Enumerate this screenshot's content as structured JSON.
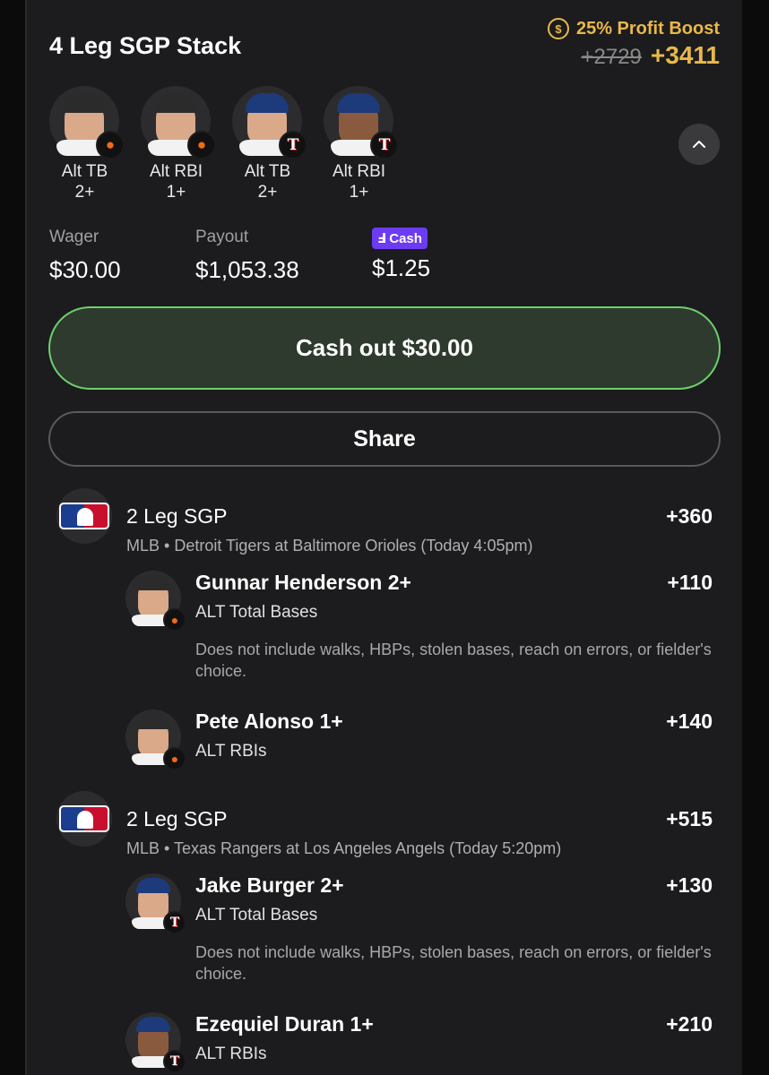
{
  "header": {
    "title": "4 Leg SGP Stack",
    "boost_label": "25% Profit Boost",
    "boost_icon": "dollar-coin-icon",
    "old_odds": "+2729",
    "new_odds": "+3411",
    "accent": "#e8b84a"
  },
  "legs": [
    {
      "label_line1": "Alt TB",
      "label_line2": "2+",
      "team": "BAL"
    },
    {
      "label_line1": "Alt RBI",
      "label_line2": "1+",
      "team": "BAL"
    },
    {
      "label_line1": "Alt TB",
      "label_line2": "2+",
      "team": "TEX"
    },
    {
      "label_line1": "Alt RBI",
      "label_line2": "1+",
      "team": "TEX"
    }
  ],
  "summary": {
    "wager_label": "Wager",
    "wager_value": "$30.00",
    "payout_label": "Payout",
    "payout_value": "$1,053.38",
    "fcash_label": "Cash",
    "fcash_value": "$1.25"
  },
  "actions": {
    "cashout_label": "Cash out $30.00",
    "share_label": "Share"
  },
  "sgps": [
    {
      "title": "2 Leg SGP",
      "odds": "+360",
      "subtitle": "MLB • Detroit Tigers at Baltimore Orioles (Today 4:05pm)",
      "picks": [
        {
          "name": "Gunnar Henderson 2+",
          "odds": "+110",
          "market": "ALT Total Bases",
          "note": "Does not include walks, HBPs, stolen bases, reach on errors, or fielder's choice."
        },
        {
          "name": "Pete Alonso 1+",
          "odds": "+140",
          "market": "ALT RBIs"
        }
      ]
    },
    {
      "title": "2 Leg SGP",
      "odds": "+515",
      "subtitle": "MLB • Texas Rangers at Los Angeles Angels (Today 5:20pm)",
      "picks": [
        {
          "name": "Jake Burger 2+",
          "odds": "+130",
          "market": "ALT Total Bases",
          "note": "Does not include walks, HBPs, stolen bases, reach on errors, or fielder's choice."
        },
        {
          "name": "Ezequiel Duran 1+",
          "odds": "+210",
          "market": "ALT RBIs"
        }
      ]
    }
  ]
}
